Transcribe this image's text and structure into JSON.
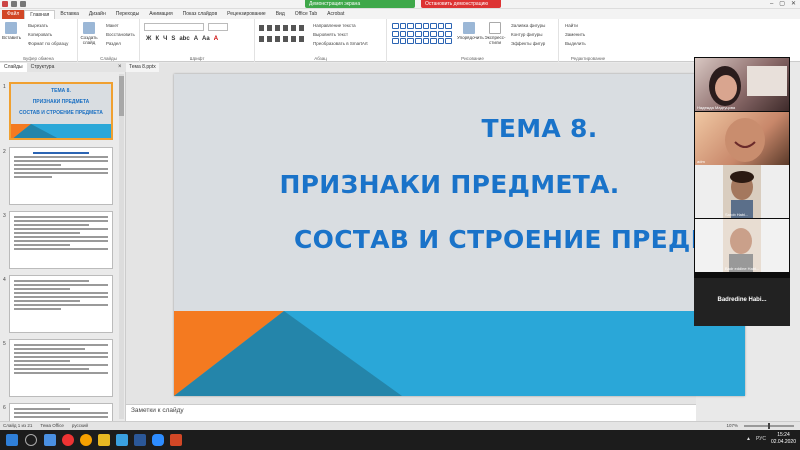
{
  "titlebar": {
    "share_status": "Демонстрация экрана",
    "stop_share": "Остановить демонстрацию",
    "win_min": "–",
    "win_max": "▢",
    "win_close": "✕"
  },
  "tabs": [
    "Файл",
    "Главная",
    "Вставка",
    "Дизайн",
    "Переходы",
    "Анимация",
    "Показ слайдов",
    "Рецензирование",
    "Вид",
    "Office Tab",
    "Acrobat"
  ],
  "ribbon": {
    "clipboard": {
      "paste": "Вставить",
      "cut": "Вырезать",
      "copy": "Копировать",
      "format": "Формат по образцу",
      "label": "Буфер обмена"
    },
    "slides": {
      "new_slide": "Создать слайд",
      "layout": "Макет",
      "reset": "Восстановить",
      "section": "Раздел",
      "label": "Слайды"
    },
    "font": {
      "label": "Шрифт",
      "bold": "Ж",
      "italic": "К",
      "underline": "Ч",
      "strike": "S",
      "shadow": "abc",
      "size_up": "A",
      "aa": "Aa",
      "font_color": "A"
    },
    "paragraph": {
      "label": "Абзац",
      "text_dir": "Направление текста",
      "align_text": "Выровнять текст",
      "smartart": "Преобразовать в SmartArt"
    },
    "drawing": {
      "label": "Рисование",
      "arrange": "Упорядочить",
      "quick_styles": "Экспресс-стили",
      "fill": "Заливка фигуры",
      "outline": "Контур фигуры",
      "effects": "Эффекты фигур"
    },
    "editing": {
      "label": "Редактирование",
      "find": "Найти",
      "replace": "Заменить",
      "select": "Выделить"
    }
  },
  "panel": {
    "tab_slides": "Слайды",
    "tab_outline": "Структура",
    "close": "×",
    "doc_tab": "Тема 8.pptx",
    "thumbs": [
      {
        "num": "1",
        "lines": [
          "ТЕМА 8.",
          "ПРИЗНАКИ ПРЕДМЕТА",
          "СОСТАВ И СТРОЕНИЕ ПРЕДМЕТА"
        ]
      },
      {
        "num": "2"
      },
      {
        "num": "3"
      },
      {
        "num": "4"
      },
      {
        "num": "5"
      },
      {
        "num": "6"
      }
    ]
  },
  "slide": {
    "title_line1": "ТЕМА 8.",
    "title_line2": "ПРИЗНАКИ ПРЕДМЕТА.",
    "title_line3": "СОСТАВ И СТРОЕНИЕ ПРЕДМЕТА",
    "colors": {
      "title": "#1a73c9",
      "background": "#d9dde1",
      "orange": "#f47a20",
      "blue": "#2aa7d8",
      "dark_blue": "#2485aa"
    }
  },
  "notes": {
    "placeholder": "Заметки к слайду"
  },
  "video": {
    "participants": [
      {
        "name": "Надежда Мадгуцова"
      },
      {
        "name": "adm"
      },
      {
        "name": "Sarob Habi..."
      },
      {
        "name": "Badr eddine Habi..."
      }
    ],
    "active_speaker": "Badredine  Habi..."
  },
  "statusbar": {
    "slide_info": "Слайд 1 из 21",
    "theme": "Тема Office",
    "language": "русский",
    "zoom": "107%"
  },
  "taskbar": {
    "lang": "РУС",
    "time": "15:24",
    "date": "02.04.2020",
    "apps": [
      "windows-start",
      "search",
      "chrome",
      "opera",
      "yandex",
      "explorer",
      "store",
      "word",
      "zoom",
      "powerpoint"
    ]
  }
}
